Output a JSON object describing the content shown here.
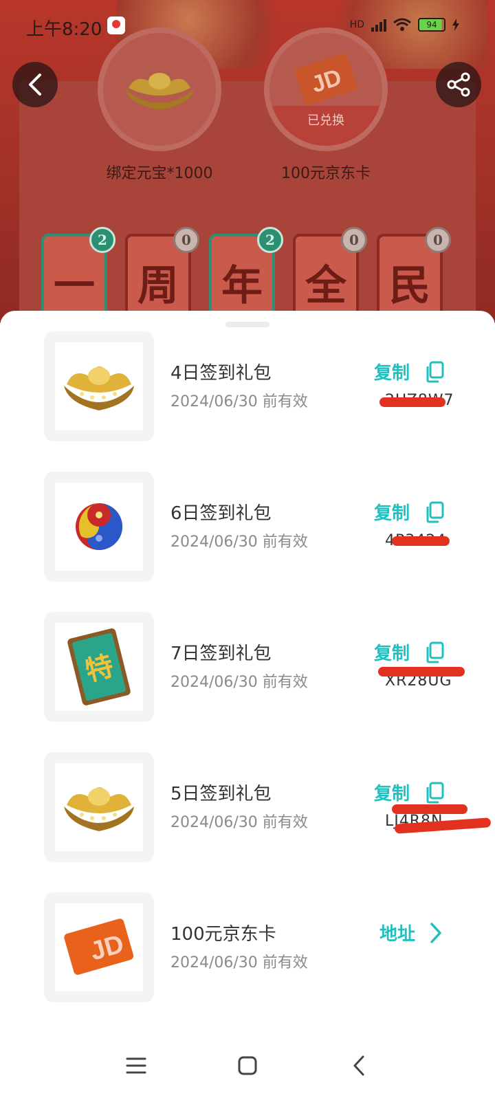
{
  "status_bar": {
    "time": "上午8:20",
    "network": "HD",
    "battery": "94"
  },
  "rewards": [
    {
      "label": "绑定元宝*1000",
      "icon": "gold-ingot-icon"
    },
    {
      "label": "100元京东卡",
      "icon": "jd-card-icon",
      "badge": "已兑换"
    }
  ],
  "characters": [
    {
      "char": "一",
      "count": "2",
      "active": true
    },
    {
      "char": "周",
      "count": "0",
      "active": false
    },
    {
      "char": "年",
      "count": "2",
      "active": true
    },
    {
      "char": "全",
      "count": "0",
      "active": false
    },
    {
      "char": "民",
      "count": "0",
      "active": false
    }
  ],
  "gifts": [
    {
      "title": "4日签到礼包",
      "expiry": "2024/06/30 前有效",
      "action": "复制",
      "code": "2UZ8W7",
      "icon": "gold-ingot-icon"
    },
    {
      "title": "6日签到礼包",
      "expiry": "2024/06/30 前有效",
      "action": "复制",
      "code": "4P3424",
      "icon": "taiji-orb-icon"
    },
    {
      "title": "7日签到礼包",
      "expiry": "2024/06/30 前有效",
      "action": "复制",
      "code": "XR28UG",
      "icon": "special-card-icon"
    },
    {
      "title": "5日签到礼包",
      "expiry": "2024/06/30 前有效",
      "action": "复制",
      "code": "LJ4R8N",
      "icon": "gold-ingot-icon"
    },
    {
      "title": "100元京东卡",
      "expiry": "2024/06/30 前有效",
      "action": "地址",
      "icon": "jd-card-icon"
    }
  ],
  "colors": {
    "accent": "#1ec0c0",
    "redaction": "#e2321f",
    "background_red": "#a8332a"
  }
}
